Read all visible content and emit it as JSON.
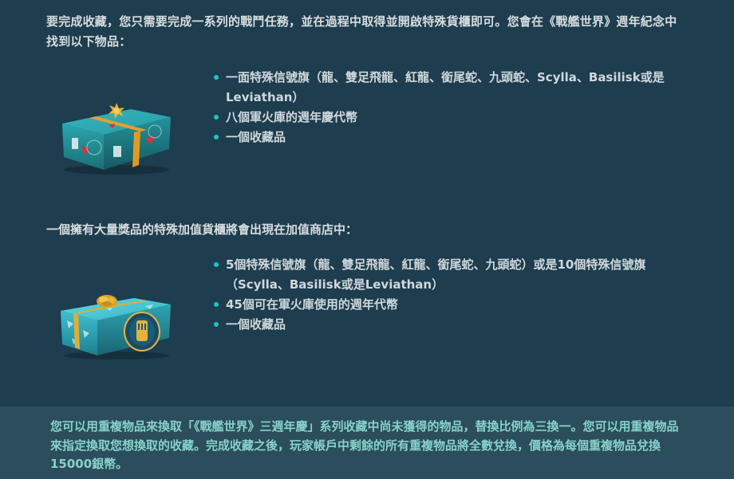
{
  "intro": {
    "text": "要完成收藏，您只需要完成一系列的戰鬥任務，並在過程中取得並開啟特殊貨櫃即可。您會在《戰艦世界》週年紀念中找到以下物品："
  },
  "section1": {
    "image_alt": "teal-gift-box",
    "items": [
      "一面特殊信號旗（龍、雙足飛龍、紅龍、銜尾蛇、九頭蛇、Scylla、Basilisk或是Leviathan）",
      "八個軍火庫的週年慶代幣",
      "一個收藏品"
    ]
  },
  "section2": {
    "heading": "一個擁有大量獎品的特殊加值貨櫃將會出現在加值商店中：",
    "image_alt": "premium-gift-box",
    "items": [
      "5個特殊信號旗（龍、雙足飛龍、紅龍、銜尾蛇、九頭蛇）或是10個特殊信號旗（Scylla、Basilisk或是Leviathan）",
      "45個可在軍火庫使用的週年代幣",
      "一個收藏品"
    ]
  },
  "footer": {
    "text": "您可以用重複物品來換取「《戰艦世界》三週年慶」系列收藏中尚未獲得的物品，替換比例為三換一。您可以用重複物品來指定換取您想換取的收藏。完成收藏之後，玩家帳戶中剩餘的所有重複物品將全數兌換，價格為每個重複物品兌換15000銀幣。"
  },
  "colors": {
    "background": "#1e3d4e",
    "footer_background": "#2c4d5b",
    "bullet": "#1fc4c9",
    "footer_text": "#86d2cc",
    "body_text": "#d6dde0"
  }
}
